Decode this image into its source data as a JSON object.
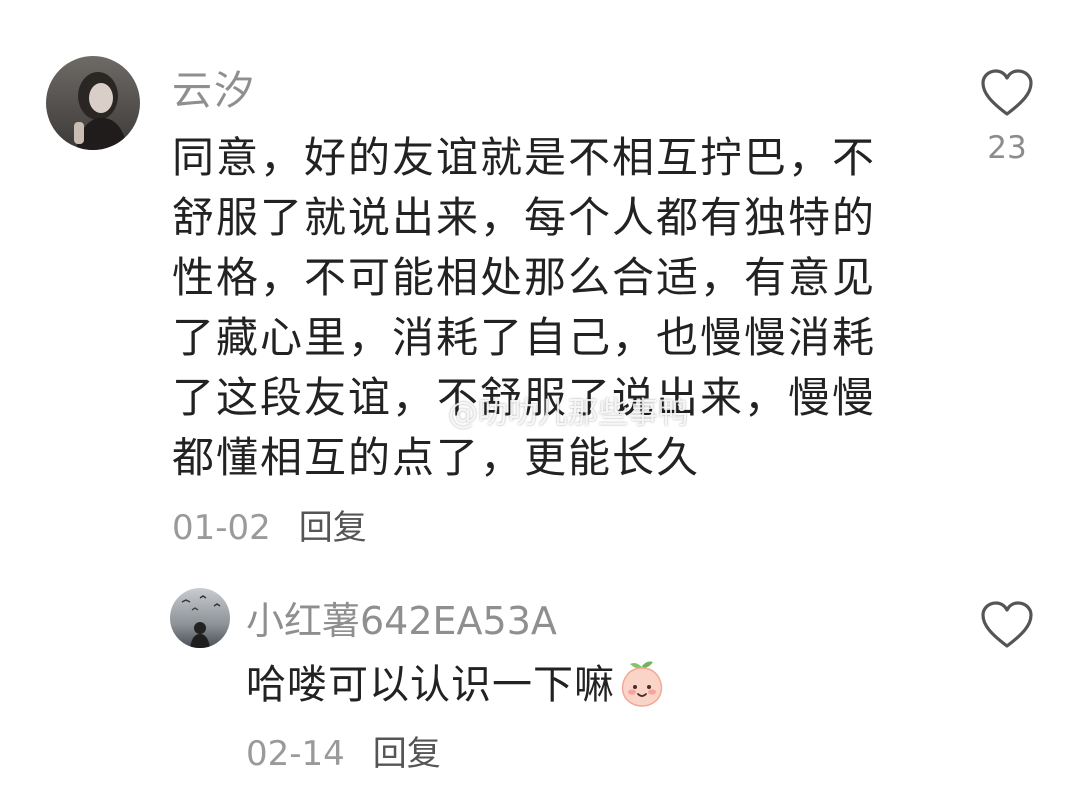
{
  "comments": [
    {
      "avatar_icon": "user-avatar",
      "username": "云汐",
      "content": "同意，好的友谊就是不相互拧巴，不舒服了就说出来，每个人都有独特的性格，不可能相处那么合适，有意见了藏心里，消耗了自己，也慢慢消耗了这段友谊，不舒服了说出来，慢慢都懂相互的点了，更能长久",
      "date": "01-02",
      "reply_label": "回复",
      "like_icon": "heart-outline-icon",
      "like_count": "23"
    },
    {
      "avatar_icon": "user-avatar",
      "username": "小红薯642EA53A",
      "content": "哈喽可以认识一下嘛",
      "emoji": "peach-face-emoji",
      "date": "02-14",
      "reply_label": "回复",
      "like_icon": "heart-outline-icon"
    }
  ],
  "watermark": {
    "icon": "weibo-logo-icon",
    "text": "@叻叻儿那些事鸭"
  },
  "colors": {
    "username": "#8f8f8f",
    "content": "#222222",
    "meta": "#9a9a9a",
    "icon_stroke": "#555555"
  }
}
